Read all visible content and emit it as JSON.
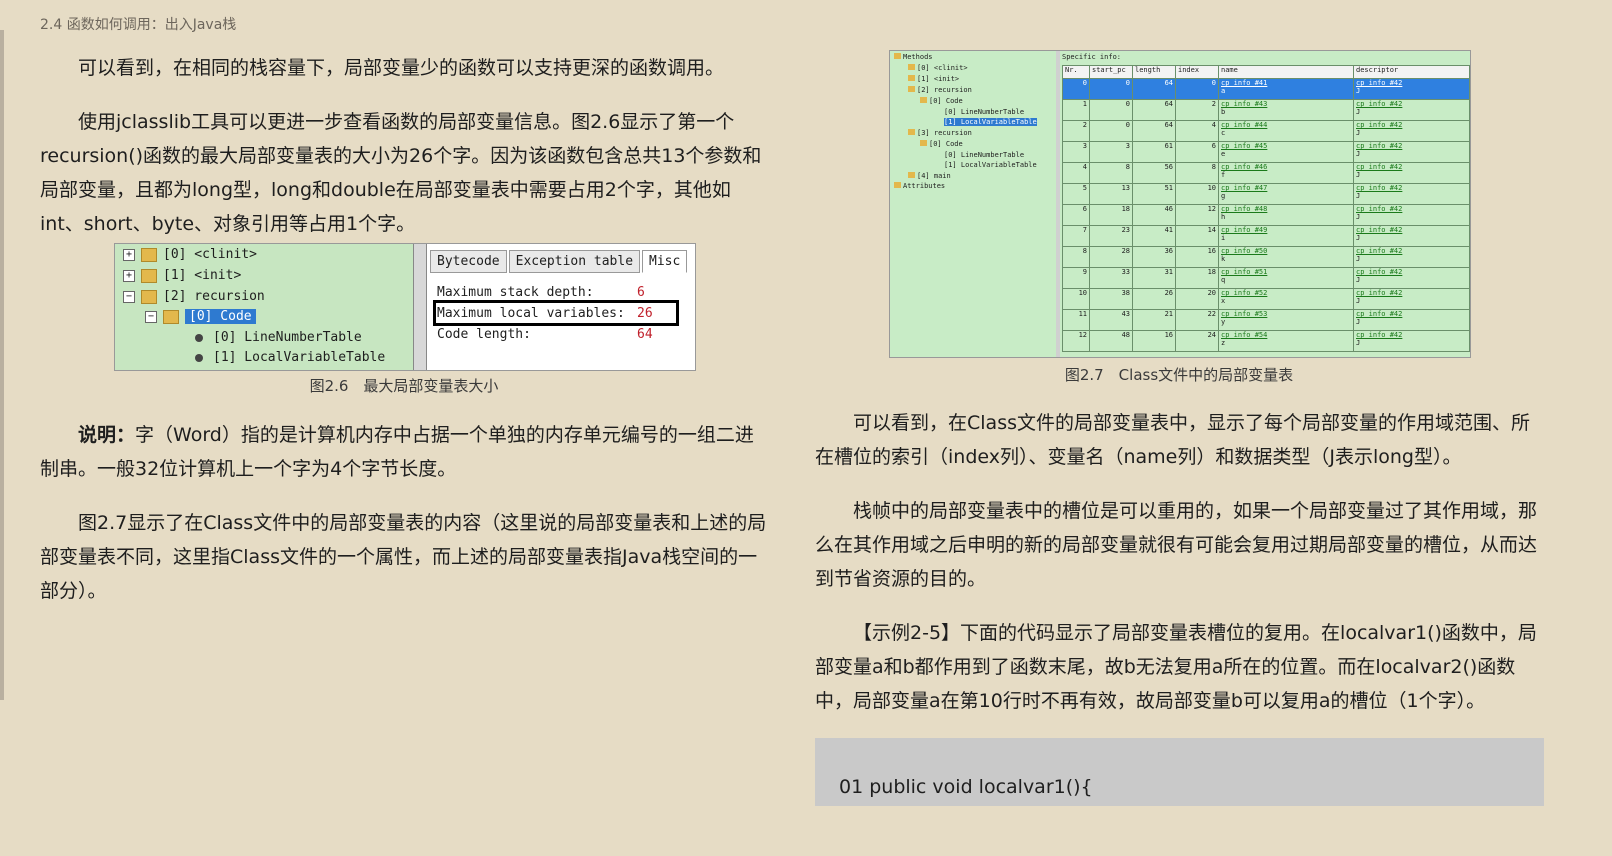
{
  "header": {
    "breadcrumb": "2.4 函数如何调用：出入Java栈"
  },
  "left": {
    "p1": "可以看到，在相同的栈容量下，局部变量少的函数可以支持更深的函数调用。",
    "p2": "使用jclasslib工具可以更进一步查看函数的局部变量信息。图2.6显示了第一个recursion()函数的最大局部变量表的大小为26个字。因为该函数包含总共13个参数和局部变量，且都为long型，long和double在局部变量表中需要占用2个字，其他如int、short、byte、对象引用等占用1个字。",
    "fig26_caption": "图2.6　最大局部变量表大小",
    "note_label": "说明：",
    "note_text": "字（Word）指的是计算机内存中占据一个单独的内存单元编号的一组二进制串。一般32位计算机上一个字为4个字节长度。",
    "p4": "图2.7显示了在Class文件中的局部变量表的内容（这里说的局部变量表和上述的局部变量表不同，这里指Class文件的一个属性，而上述的局部变量表指Java栈空间的一部分）。"
  },
  "fig26": {
    "tree": {
      "n0": "[0] <clinit>",
      "n1": "[1] <init>",
      "n2": "[2] recursion",
      "n3": "[0] Code",
      "n4": "[0] LineNumberTable",
      "n5": "[1] LocalVariableTable"
    },
    "tabs": {
      "bytecode": "Bytecode",
      "exception": "Exception table",
      "misc": "Misc"
    },
    "misc": {
      "l1": "Maximum stack depth:",
      "v1": "6",
      "l2": "Maximum local variables:",
      "v2": "26",
      "l3": "Code length:",
      "v3": "64"
    }
  },
  "fig27": {
    "tree": {
      "methods": "Methods",
      "m0": "[0] <clinit>",
      "m1": "[1] <init>",
      "m2": "[2] recursion",
      "m2code": "[0] Code",
      "m2lnt": "[0] LineNumberTable",
      "m2lvt": "[1] LocalVariableTable",
      "m3": "[3] recursion",
      "m3code": "[0] Code",
      "m3lnt": "[0] LineNumberTable",
      "m3lvt": "[1] LocalVariableTable",
      "m4": "[4] main",
      "attrs": "Attributes"
    },
    "specific": "Specific info:",
    "headers": {
      "nr": "Nr.",
      "start": "start_pc",
      "length": "length",
      "index": "index",
      "name": "name",
      "descriptor": "descriptor"
    },
    "rows": [
      {
        "nr": "0",
        "start": "0",
        "length": "64",
        "index": "0",
        "name": "cp_info #41",
        "sub": "a",
        "desc": "cp_info #42",
        "dsub": "J"
      },
      {
        "nr": "1",
        "start": "0",
        "length": "64",
        "index": "2",
        "name": "cp_info #43",
        "sub": "b",
        "desc": "cp_info #42",
        "dsub": "J"
      },
      {
        "nr": "2",
        "start": "0",
        "length": "64",
        "index": "4",
        "name": "cp_info #44",
        "sub": "c",
        "desc": "cp_info #42",
        "dsub": "J"
      },
      {
        "nr": "3",
        "start": "3",
        "length": "61",
        "index": "6",
        "name": "cp_info #45",
        "sub": "e",
        "desc": "cp_info #42",
        "dsub": "J"
      },
      {
        "nr": "4",
        "start": "8",
        "length": "56",
        "index": "8",
        "name": "cp_info #46",
        "sub": "f",
        "desc": "cp_info #42",
        "dsub": "J"
      },
      {
        "nr": "5",
        "start": "13",
        "length": "51",
        "index": "10",
        "name": "cp_info #47",
        "sub": "g",
        "desc": "cp_info #42",
        "dsub": "J"
      },
      {
        "nr": "6",
        "start": "18",
        "length": "46",
        "index": "12",
        "name": "cp_info #48",
        "sub": "h",
        "desc": "cp_info #42",
        "dsub": "J"
      },
      {
        "nr": "7",
        "start": "23",
        "length": "41",
        "index": "14",
        "name": "cp_info #49",
        "sub": "i",
        "desc": "cp_info #42",
        "dsub": "J"
      },
      {
        "nr": "8",
        "start": "28",
        "length": "36",
        "index": "16",
        "name": "cp_info #50",
        "sub": "k",
        "desc": "cp_info #42",
        "dsub": "J"
      },
      {
        "nr": "9",
        "start": "33",
        "length": "31",
        "index": "18",
        "name": "cp_info #51",
        "sub": "q",
        "desc": "cp_info #42",
        "dsub": "J"
      },
      {
        "nr": "10",
        "start": "38",
        "length": "26",
        "index": "20",
        "name": "cp_info #52",
        "sub": "x",
        "desc": "cp_info #42",
        "dsub": "J"
      },
      {
        "nr": "11",
        "start": "43",
        "length": "21",
        "index": "22",
        "name": "cp_info #53",
        "sub": "y",
        "desc": "cp_info #42",
        "dsub": "J"
      },
      {
        "nr": "12",
        "start": "48",
        "length": "16",
        "index": "24",
        "name": "cp_info #54",
        "sub": "z",
        "desc": "cp_info #42",
        "dsub": "J"
      }
    ]
  },
  "right": {
    "fig27_caption": "图2.7　Class文件中的局部变量表",
    "p1": "可以看到，在Class文件的局部变量表中，显示了每个局部变量的作用域范围、所在槽位的索引（index列）、变量名（name列）和数据类型（J表示long型）。",
    "p2": "栈帧中的局部变量表中的槽位是可以重用的，如果一个局部变量过了其作用域，那么在其作用域之后申明的新的局部变量就很有可能会复用过期局部变量的槽位，从而达到节省资源的目的。",
    "p3": "【示例2-5】下面的代码显示了局部变量表槽位的复用。在localvar1()函数中，局部变量a和b都作用到了函数末尾，故b无法复用a所在的位置。而在localvar2()函数中，局部变量a在第10行时不再有效，故局部变量b可以复用a的槽位（1个字）。",
    "code_line1": "01 public void localvar1(){"
  }
}
